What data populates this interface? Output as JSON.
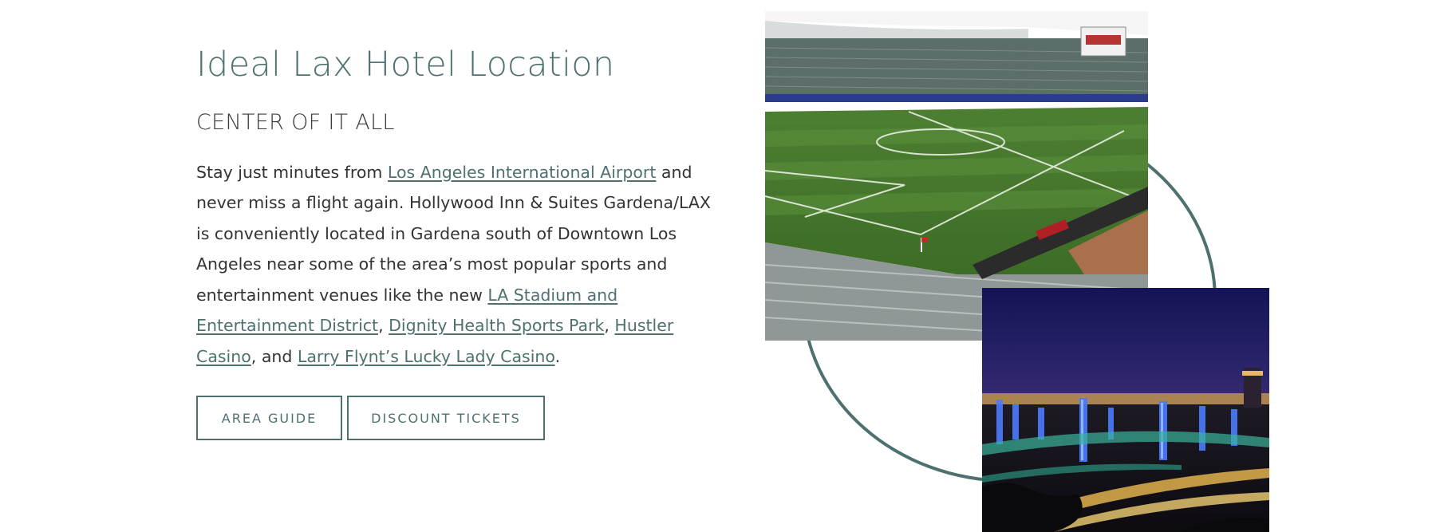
{
  "section": {
    "title": "Ideal Lax Hotel Location",
    "subtitle": "CENTER OF IT ALL"
  },
  "paragraph": {
    "text_1": "Stay just minutes from ",
    "link_airport": "Los Angeles International Airport",
    "text_2": " and never miss a flight again. Hollywood Inn & Suites Gardena/LAX is conveniently located in Gardena south of Downtown Los Angeles near some of the area’s most popular sports and entertainment venues like the new ",
    "link_la_stadium": "LA Stadium and Entertainment District",
    "text_3": ", ",
    "link_dignity": "Dignity Health Sports Park",
    "text_4": ", ",
    "link_hustler": "Hustler Casino",
    "text_5": ", and ",
    "link_larry_flynt": "Larry Flynt’s Lucky Lady Casino",
    "text_6": "."
  },
  "buttons": {
    "area_guide": "AREA GUIDE",
    "discount_tickets": "DISCOUNT TICKETS"
  },
  "colors": {
    "accent": "#4e7170",
    "body_text": "#333333",
    "background": "#ffffff"
  },
  "images": {
    "photo_1": "stadium-photo",
    "photo_2": "lax-night-pylons-photo"
  }
}
